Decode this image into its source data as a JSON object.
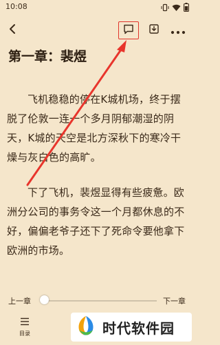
{
  "status_bar": {
    "time": "10:08",
    "icons": [
      "vibrate-icon",
      "wifi-icon",
      "battery-icon"
    ]
  },
  "toolbar": {
    "back_icon": "chevron-left-icon",
    "comment_icon": "comment-icon",
    "download_icon": "download-icon",
    "more_icon": "more-dots-icon"
  },
  "chapter": {
    "title": "第一章：裴煜",
    "paragraphs": [
      "飞机稳稳的停在K城机场，终于摆脱了伦敦一连一个多月阴郁潮湿的阴天，K城的天空是北方深秋下的寒冷干燥与灰白色的高旷。",
      "下了飞机，裴煜显得有些疲惫。欧洲分公司的事务令这一个月都休息的不好，偏偏老爷子还下了死命令要他拿下欧洲的市场。"
    ]
  },
  "reader_controls": {
    "prev_chapter": "上一章",
    "next_chapter": "下一章",
    "progress": 0.0
  },
  "bottom_bar": {
    "toc_label": "目录"
  },
  "watermark": {
    "text": "时代软件园"
  },
  "colors": {
    "page_background": "#f5e6cb",
    "text": "#3b2a1a",
    "highlight": "#e0342b"
  }
}
